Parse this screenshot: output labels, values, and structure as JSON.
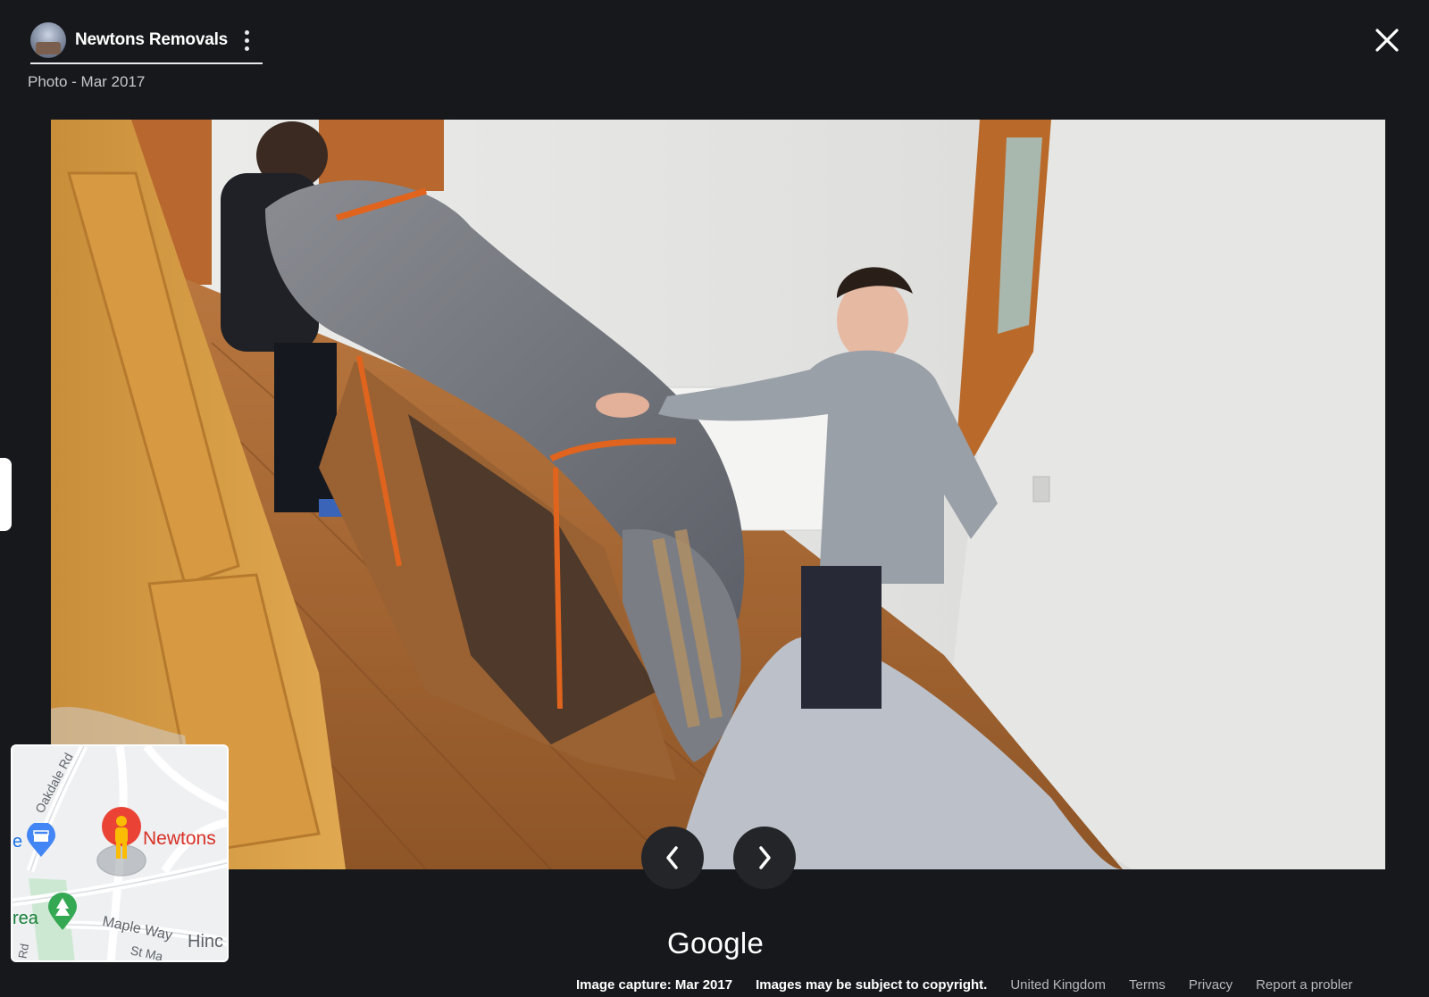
{
  "header": {
    "title": "Newtons Removals",
    "subtitle": "Photo - Mar 2017"
  },
  "minimap": {
    "road_oakdale": "Oakdale Rd",
    "road_maple": "Maple Way",
    "pin_label": "Newtons",
    "area_fragment": "rea",
    "left_fragment": "e",
    "right_fragment": "Hinc",
    "bottom_fragment": "St Ma",
    "corner_fragment": "Rd"
  },
  "branding": {
    "logo_text": "Google"
  },
  "footer": {
    "image_capture": "Image capture: Mar 2017",
    "copyright": "Images may be subject to copyright.",
    "region": "United Kingdom",
    "terms": "Terms",
    "privacy": "Privacy",
    "report": "Report a probler"
  },
  "colors": {
    "background": "#16181c",
    "pin_red": "#d93025",
    "park_green": "#188038",
    "place_blue": "#1a73e8"
  }
}
